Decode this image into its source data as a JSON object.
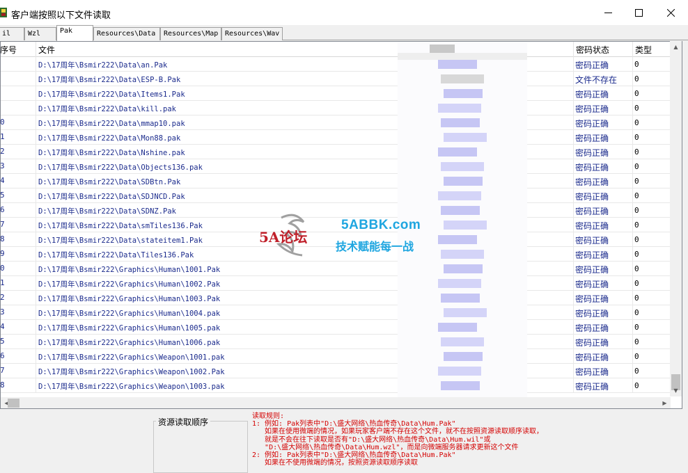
{
  "window": {
    "title": "客户端按照以下文件读取",
    "controls": {
      "minimize": "—",
      "maximize": "☐",
      "close": "✕"
    }
  },
  "tabs": [
    {
      "label": "il",
      "active": false
    },
    {
      "label": "Wzl",
      "active": false
    },
    {
      "label": "Pak",
      "active": true
    },
    {
      "label": "Resources\\Data",
      "active": false
    },
    {
      "label": "Resources\\Map",
      "active": false
    },
    {
      "label": "Resources\\Wav",
      "active": false
    }
  ],
  "table": {
    "columns": {
      "index": "序号",
      "file": "文件",
      "status": "密码状态",
      "type": "类型"
    },
    "rows": [
      {
        "index": "",
        "file": "D:\\17周年\\Bsmir222\\Data\\an.Pak",
        "status": "密码正确",
        "type": "0"
      },
      {
        "index": "",
        "file": "D:\\17周年\\Bsmir222\\Data\\ESP-B.Pak",
        "status": "文件不存在",
        "type": "0"
      },
      {
        "index": "",
        "file": "D:\\17周年\\Bsmir222\\Data\\Items1.Pak",
        "status": "密码正确",
        "type": "0"
      },
      {
        "index": "",
        "file": "D:\\17周年\\Bsmir222\\Data\\kill.pak",
        "status": "密码正确",
        "type": "0"
      },
      {
        "index": "0",
        "file": "D:\\17周年\\Bsmir222\\Data\\mmap10.pak",
        "status": "密码正确",
        "type": "0"
      },
      {
        "index": "1",
        "file": "D:\\17周年\\Bsmir222\\Data\\Mon88.pak",
        "status": "密码正确",
        "type": "0"
      },
      {
        "index": "2",
        "file": "D:\\17周年\\Bsmir222\\Data\\Nshine.pak",
        "status": "密码正确",
        "type": "0"
      },
      {
        "index": "3",
        "file": "D:\\17周年\\Bsmir222\\Data\\Objects136.pak",
        "status": "密码正确",
        "type": "0"
      },
      {
        "index": "4",
        "file": "D:\\17周年\\Bsmir222\\Data\\SDBtn.Pak",
        "status": "密码正确",
        "type": "0"
      },
      {
        "index": "5",
        "file": "D:\\17周年\\Bsmir222\\Data\\SDJNCD.Pak",
        "status": "密码正确",
        "type": "0"
      },
      {
        "index": "6",
        "file": "D:\\17周年\\Bsmir222\\Data\\SDNZ.Pak",
        "status": "密码正确",
        "type": "0"
      },
      {
        "index": "7",
        "file": "D:\\17周年\\Bsmir222\\Data\\smTiles136.Pak",
        "status": "密码正确",
        "type": "0"
      },
      {
        "index": "8",
        "file": "D:\\17周年\\Bsmir222\\Data\\stateitem1.Pak",
        "status": "密码正确",
        "type": "0"
      },
      {
        "index": "9",
        "file": "D:\\17周年\\Bsmir222\\Data\\Tiles136.Pak",
        "status": "密码正确",
        "type": "0"
      },
      {
        "index": "0",
        "file": "D:\\17周年\\Bsmir222\\Graphics\\Human\\1001.Pak",
        "status": "密码正确",
        "type": "0"
      },
      {
        "index": "1",
        "file": "D:\\17周年\\Bsmir222\\Graphics\\Human\\1002.Pak",
        "status": "密码正确",
        "type": "0"
      },
      {
        "index": "2",
        "file": "D:\\17周年\\Bsmir222\\Graphics\\Human\\1003.Pak",
        "status": "密码正确",
        "type": "0"
      },
      {
        "index": "3",
        "file": "D:\\17周年\\Bsmir222\\Graphics\\Human\\1004.pak",
        "status": "密码正确",
        "type": "0"
      },
      {
        "index": "4",
        "file": "D:\\17周年\\Bsmir222\\Graphics\\Human\\1005.pak",
        "status": "密码正确",
        "type": "0"
      },
      {
        "index": "5",
        "file": "D:\\17周年\\Bsmir222\\Graphics\\Human\\1006.pak",
        "status": "密码正确",
        "type": "0"
      },
      {
        "index": "6",
        "file": "D:\\17周年\\Bsmir222\\Graphics\\Weapon\\1001.pak",
        "status": "密码正确",
        "type": "0"
      },
      {
        "index": "7",
        "file": "D:\\17周年\\Bsmir222\\Graphics\\Weapon\\1002.Pak",
        "status": "密码正确",
        "type": "0"
      },
      {
        "index": "8",
        "file": "D:\\17周年\\Bsmir222\\Graphics\\Weapon\\1003.pak",
        "status": "密码正确",
        "type": "0"
      }
    ]
  },
  "resource_order": {
    "label": "资源读取顺序"
  },
  "rules": {
    "text": "读取规则:\n1: 例如: Pak列表中\"D:\\盛大网络\\热血传奇\\Data\\Hum.Pak\"\n   如果在使用微端的情况，如果玩家客户端不存在这个文件，就不在按照资源读取顺序读取，\n   就是不会在往下读取是否有\"D:\\盛大网络\\热血传奇\\Data\\Hum.wil\"或\n   \"D:\\盛大网络\\热血传奇\\Data\\Hum.wzl\"，而是向微端服务器请求更新这个文件\n2: 例如: Pak列表中\"D:\\盛大网络\\热血传奇\\Data\\Hum.Pak\"\n   如果在不使用微端的情况，按照资源读取顺序读取"
  },
  "watermark": {
    "logo": "5A论坛",
    "site": "5ABBK.com",
    "slogan": "技术赋能每一战"
  },
  "colors": {
    "row_text": "#1a2a8c",
    "rules_text": "#d40000",
    "watermark": "#1fa6e0"
  }
}
